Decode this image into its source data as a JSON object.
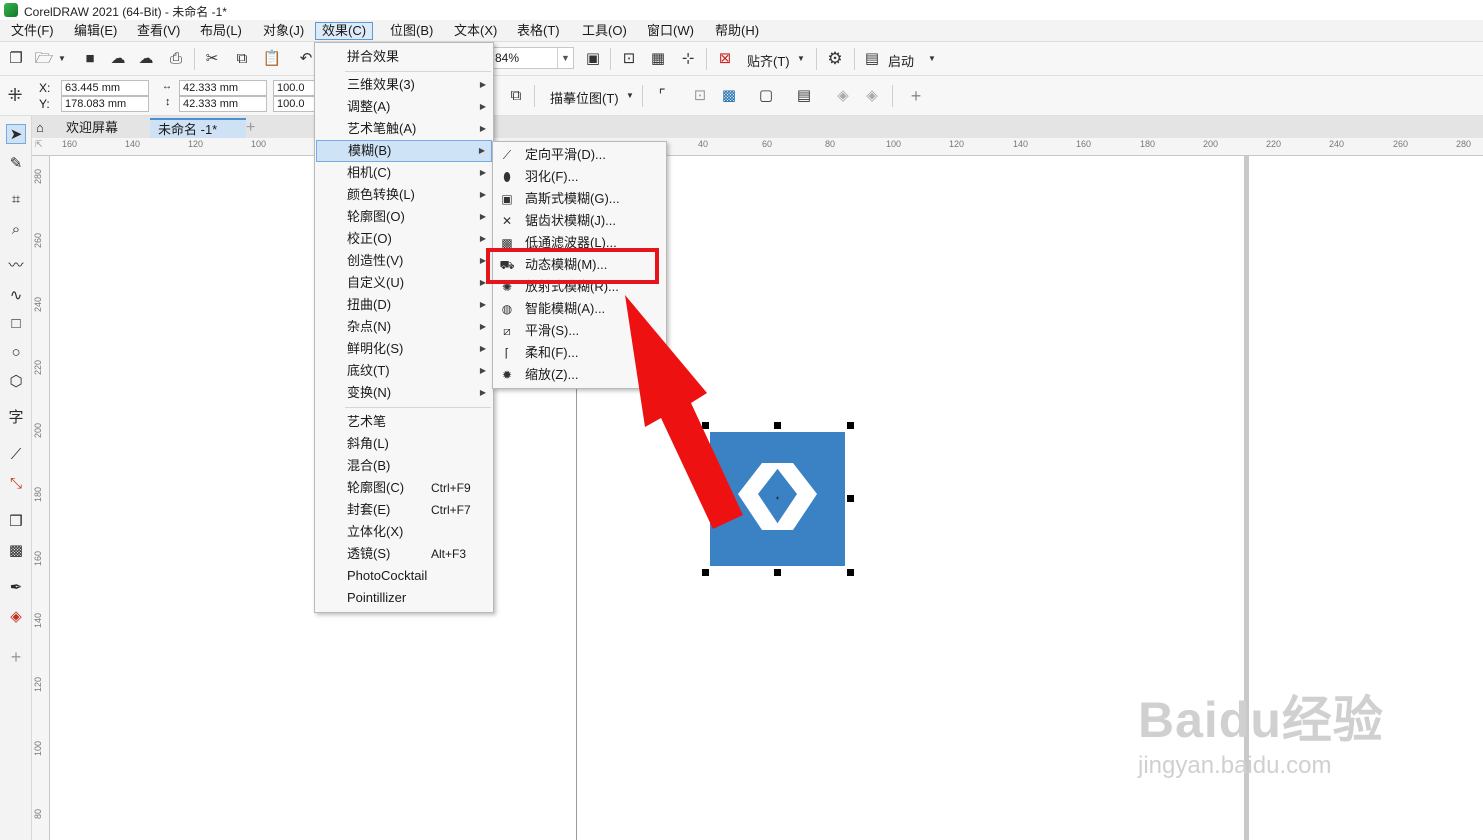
{
  "window": {
    "title": "CorelDRAW 2021 (64-Bit) - 未命名 -1*"
  },
  "menubar": [
    "文件(F)",
    "编辑(E)",
    "查看(V)",
    "布局(L)",
    "对象(J)",
    "效果(C)",
    "位图(B)",
    "文本(X)",
    "表格(T)",
    "工具(O)",
    "窗口(W)",
    "帮助(H)"
  ],
  "toolbar": {
    "zoom": "84%",
    "snap_label": "贴齐(T)",
    "launch_label": "启动"
  },
  "property_bar": {
    "x_label": "X:",
    "y_label": "Y:",
    "x_value": "63.445 mm",
    "y_value": "178.083 mm",
    "width_value": "42.333 mm",
    "height_value": "42.333 mm",
    "scale_x": "100.0",
    "scale_y": "100.0",
    "trace_label": "描摹位图(T)"
  },
  "tabs": {
    "welcome": "欢迎屏幕",
    "document": "未命名 -1*"
  },
  "ruler": {
    "h_ticks": [
      "160",
      "140",
      "120",
      "100",
      "40",
      "60",
      "80",
      "100",
      "120",
      "140",
      "160",
      "180",
      "200",
      "220",
      "240",
      "260",
      "280"
    ],
    "v_ticks": [
      "280",
      "260",
      "240",
      "220",
      "200",
      "180",
      "160",
      "140",
      "120",
      "100",
      "80"
    ]
  },
  "effects_menu": {
    "items": [
      {
        "label": "拼合效果"
      },
      {
        "label": "三维效果(3)",
        "submenu": true
      },
      {
        "label": "调整(A)",
        "submenu": true
      },
      {
        "label": "艺术笔触(A)",
        "submenu": true
      },
      {
        "label": "模糊(B)",
        "submenu": true,
        "highlighted": true
      },
      {
        "label": "相机(C)",
        "submenu": true
      },
      {
        "label": "颜色转换(L)",
        "submenu": true
      },
      {
        "label": "轮廓图(O)",
        "submenu": true
      },
      {
        "label": "校正(O)",
        "submenu": true
      },
      {
        "label": "创造性(V)",
        "submenu": true
      },
      {
        "label": "自定义(U)",
        "submenu": true
      },
      {
        "label": "扭曲(D)",
        "submenu": true
      },
      {
        "label": "杂点(N)",
        "submenu": true
      },
      {
        "label": "鲜明化(S)",
        "submenu": true
      },
      {
        "label": "底纹(T)",
        "submenu": true
      },
      {
        "label": "变换(N)",
        "submenu": true
      },
      {
        "label": "艺术笔"
      },
      {
        "label": "斜角(L)"
      },
      {
        "label": "混合(B)"
      },
      {
        "label": "轮廓图(C)",
        "shortcut": "Ctrl+F9"
      },
      {
        "label": "封套(E)",
        "shortcut": "Ctrl+F7"
      },
      {
        "label": "立体化(X)"
      },
      {
        "label": "透镜(S)",
        "shortcut": "Alt+F3"
      },
      {
        "label": "PhotoCocktail"
      },
      {
        "label": "Pointillizer"
      }
    ]
  },
  "blur_submenu": {
    "items": [
      {
        "label": "定向平滑(D)...",
        "icon": "directional-smooth-icon"
      },
      {
        "label": "羽化(F)...",
        "icon": "feather-icon"
      },
      {
        "label": "高斯式模糊(G)...",
        "icon": "gaussian-blur-icon"
      },
      {
        "label": "锯齿状模糊(J)...",
        "icon": "jaggy-despeckle-icon"
      },
      {
        "label": "低通滤波器(L)...",
        "icon": "low-pass-icon"
      },
      {
        "label": "动态模糊(M)...",
        "icon": "motion-blur-icon",
        "boxed": true
      },
      {
        "label": "放射式模糊(R)...",
        "icon": "radial-blur-icon"
      },
      {
        "label": "智能模糊(A)...",
        "icon": "smart-blur-icon"
      },
      {
        "label": "平滑(S)...",
        "icon": "smooth-icon"
      },
      {
        "label": "柔和(F)...",
        "icon": "soften-icon"
      },
      {
        "label": "缩放(Z)...",
        "icon": "zoom-blur-icon"
      }
    ]
  },
  "annotation": {
    "highlight_color": "#e5151b",
    "arrow_color": "#ee1111"
  },
  "selected_object": {
    "fill": "#3a82c4",
    "logo_color": "#ffffff"
  },
  "watermark": {
    "brand": "Baidu经验",
    "url": "jingyan.baidu.com"
  }
}
